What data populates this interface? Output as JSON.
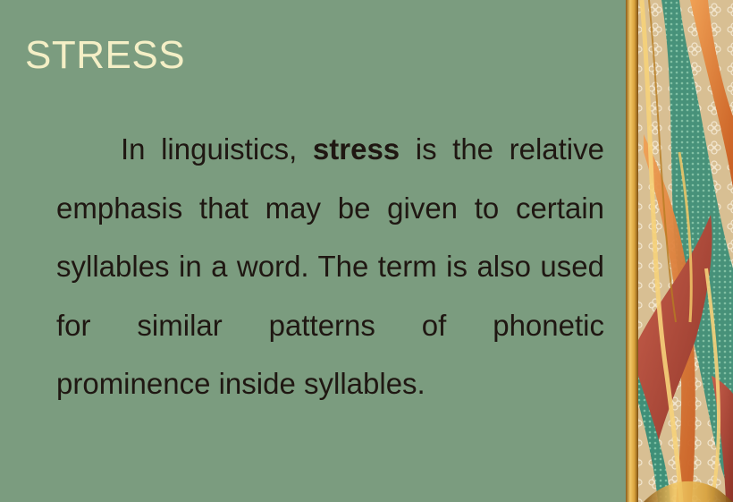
{
  "slide": {
    "title": "STRESS",
    "paragraph": {
      "lead": "In linguistics, ",
      "term": "stress",
      "rest": " is the relative emphasis that may be given to certain syllables in a word. The term is also used for similar patterns of phonetic prominence inside syllables."
    }
  },
  "colors": {
    "background": "#7b9c7f",
    "title": "#f4efc6",
    "text": "#1f1712",
    "gold": "#d9a23c",
    "tan": "#d8bf93",
    "orange": "#e07b37",
    "red": "#b24b3d",
    "teal": "#3f8f78"
  },
  "decoration": {
    "icon": "floral-ribbon-border"
  }
}
